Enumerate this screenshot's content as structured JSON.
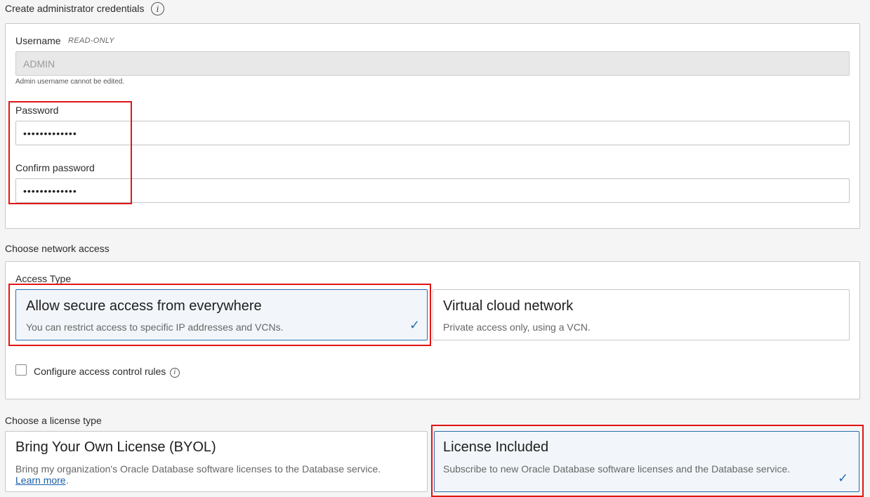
{
  "credentials": {
    "section_title": "Create administrator credentials",
    "username_label": "Username",
    "readonly_tag": "READ-ONLY",
    "username_value": "ADMIN",
    "username_helper": "Admin username cannot be edited.",
    "password_label": "Password",
    "password_value": "•••••••••••••",
    "confirm_label": "Confirm password",
    "confirm_value": "•••••••••••••"
  },
  "network": {
    "section_title": "Choose network access",
    "access_type_label": "Access Type",
    "options": [
      {
        "title": "Allow secure access from everywhere",
        "desc": "You can restrict access to specific IP addresses and VCNs.",
        "selected": true
      },
      {
        "title": "Virtual cloud network",
        "desc": "Private access only, using a VCN.",
        "selected": false
      }
    ],
    "acl_label": "Configure access control rules"
  },
  "license": {
    "section_title": "Choose a license type",
    "options": [
      {
        "title": "Bring Your Own License (BYOL)",
        "desc": "Bring my organization's Oracle Database software licenses to the Database service.",
        "link": "Learn more",
        "selected": false
      },
      {
        "title": "License Included",
        "desc": "Subscribe to new Oracle Database software licenses and the Database service.",
        "selected": true
      }
    ]
  },
  "icons": {
    "info": "i",
    "check": "✓"
  },
  "colors": {
    "accent": "#2a6dad",
    "highlight": "#e01515"
  }
}
